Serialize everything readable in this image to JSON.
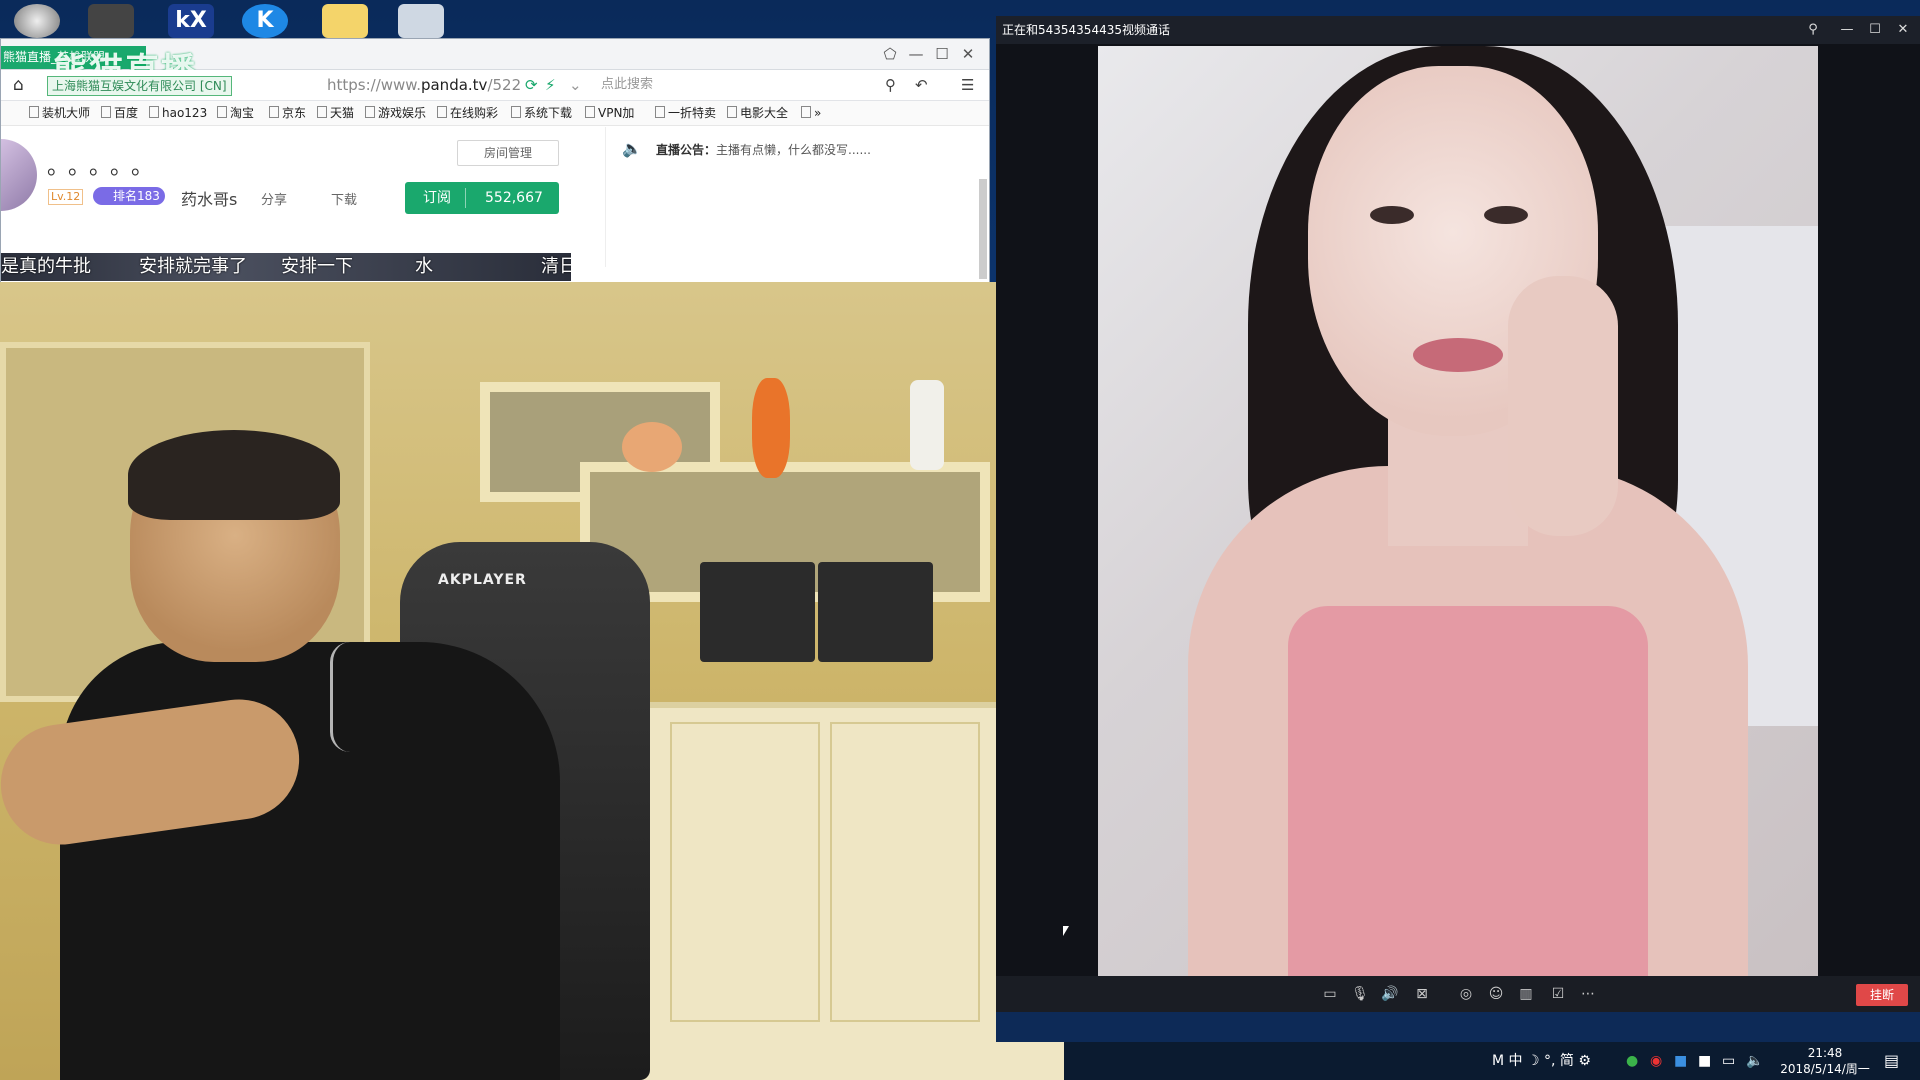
{
  "browser": {
    "tab_label": "熊猫直播_英雄联盟",
    "logo_text": "熊猫直播",
    "cert_label": "上海熊猫互娱文化有限公司 [CN]",
    "url_prefix": "https://www.",
    "url_domain": "panda.tv",
    "url_path": "/522",
    "search_placeholder": "点此搜索",
    "bookmarks": [
      "装机大师",
      "百度",
      "hao123",
      "淘宝",
      "京东",
      "天猫",
      "游戏娱乐",
      "在线购彩",
      "系统下载",
      "VPN加",
      "一折特卖",
      "电影大全"
    ],
    "bookmarks_more": "»"
  },
  "room": {
    "title_dots": "。。。。。",
    "level": "Lv.12",
    "rank": "排名183",
    "anchor": "药水哥s",
    "share": "分享",
    "download": "下载",
    "room_management": "房间管理",
    "subscribe_label": "订阅",
    "subscribe_count": "552,667",
    "announcement_label": "直播公告：",
    "announcement_text": "主播有点懒，什么都没写......",
    "danmaku": [
      "是真的牛批",
      "安排就完事了",
      "安排一下",
      "水",
      "清日"
    ]
  },
  "webcam": {
    "chair_brand": "AKPLAYER"
  },
  "call": {
    "title": "正在和54354354435视频通话",
    "hangup_label": "挂断",
    "toolbar_icons": [
      "message-icon",
      "microphone-icon",
      "speaker-icon",
      "camera-off-icon",
      "screenshot-icon",
      "effects-icon",
      "layout-icon",
      "share-screen-icon",
      "more-icon"
    ]
  },
  "taskbar": {
    "ime": "M 中 ☽ °, 简 ⚙",
    "time": "21:48",
    "date": "2018/5/14/周一"
  }
}
